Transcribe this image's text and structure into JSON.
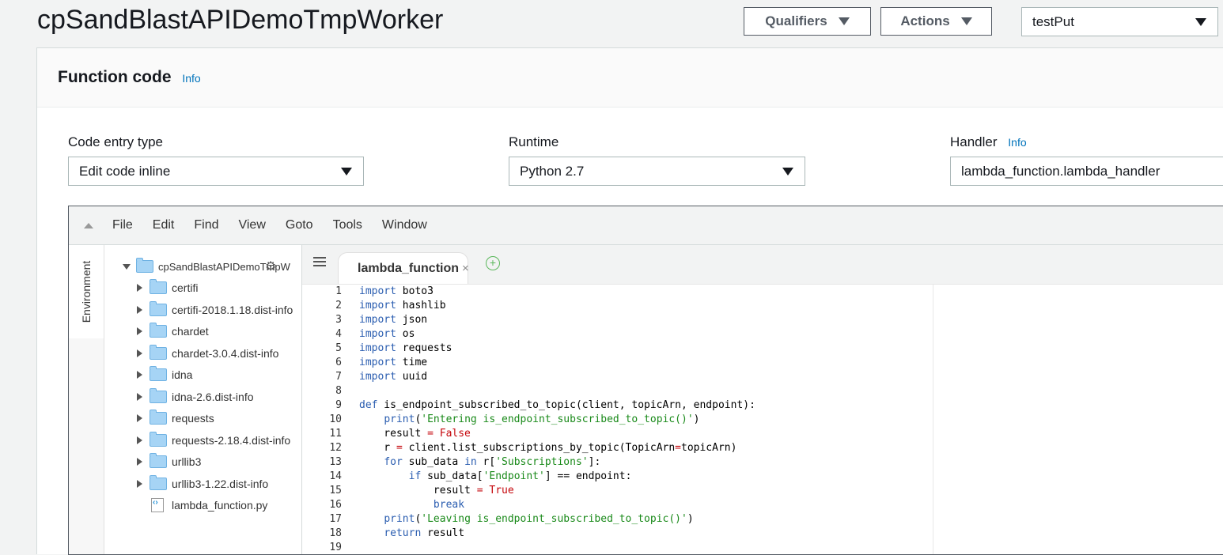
{
  "header": {
    "title": "cpSandBlastAPIDemoTmpWorker",
    "qualifiers_label": "Qualifiers",
    "actions_label": "Actions",
    "test_event": "testPut"
  },
  "function_code": {
    "title": "Function code",
    "info": "Info",
    "code_entry_type": {
      "label": "Code entry type",
      "value": "Edit code inline"
    },
    "runtime": {
      "label": "Runtime",
      "value": "Python 2.7"
    },
    "handler": {
      "label": "Handler",
      "info": "Info",
      "value": "lambda_function.lambda_handler"
    }
  },
  "ide": {
    "menu": [
      "File",
      "Edit",
      "Find",
      "View",
      "Goto",
      "Tools",
      "Window"
    ],
    "side_tab": "Environment",
    "tree": {
      "root": "cpSandBlastAPIDemoTmpW",
      "folders": [
        "certifi",
        "certifi-2018.1.18.dist-info",
        "chardet",
        "chardet-3.0.4.dist-info",
        "idna",
        "idna-2.6.dist-info",
        "requests",
        "requests-2.18.4.dist-info",
        "urllib3",
        "urllib3-1.22.dist-info"
      ],
      "file": "lambda_function.py"
    },
    "tab": {
      "label": "lambda_function",
      "close": "×"
    },
    "code_lines": [
      "import boto3",
      "import hashlib",
      "import json",
      "import os",
      "import requests",
      "import time",
      "import uuid",
      "",
      "def is_endpoint_subscribed_to_topic(client, topicArn, endpoint):",
      "    print('Entering is_endpoint_subscribed_to_topic()')",
      "    result = False",
      "    r = client.list_subscriptions_by_topic(TopicArn=topicArn)",
      "    for sub_data in r['Subscriptions']:",
      "        if sub_data['Endpoint'] == endpoint:",
      "            result = True",
      "            break",
      "    print('Leaving is_endpoint_subscribed_to_topic()')",
      "    return result",
      ""
    ]
  }
}
